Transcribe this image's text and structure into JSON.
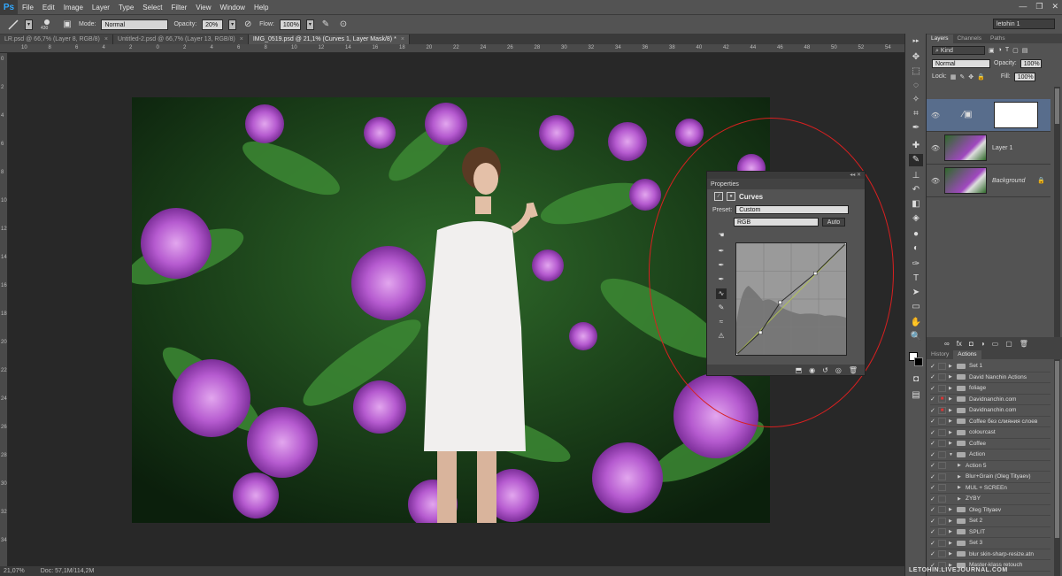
{
  "app": {
    "logo": "Ps",
    "icon_names": [
      "minimize-icon",
      "restore-icon",
      "close-icon"
    ]
  },
  "menu": [
    "File",
    "Edit",
    "Image",
    "Layer",
    "Type",
    "Select",
    "Filter",
    "View",
    "Window",
    "Help"
  ],
  "window_controls": {
    "minimize": "—",
    "restore": "❐",
    "close": "✕"
  },
  "options": {
    "brush_size": "430",
    "mode_label": "Mode:",
    "mode_value": "Normal",
    "opacity_label": "Opacity:",
    "opacity_value": "20%",
    "flow_label": "Flow:",
    "flow_value": "100%",
    "workspace": "letohin 1"
  },
  "tabs": [
    {
      "label": "LR.psd @ 66,7% (Layer 8, RGB/8)",
      "active": false
    },
    {
      "label": "Untitled-2.psd @ 66,7% (Layer 13, RGB/8)",
      "active": false
    },
    {
      "label": "IMG_0519.psd @ 21,1% (Curves 1, Layer Mask/8) *",
      "active": true
    }
  ],
  "ruler_top": [
    "10",
    "8",
    "6",
    "4",
    "2",
    "0",
    "2",
    "4",
    "6",
    "8",
    "10",
    "12",
    "14",
    "16",
    "18",
    "20",
    "22",
    "24",
    "26",
    "28",
    "30",
    "32",
    "34",
    "36",
    "38",
    "40",
    "42",
    "44",
    "46",
    "48",
    "50",
    "52",
    "54"
  ],
  "ruler_left": [
    "0",
    "2",
    "4",
    "6",
    "8",
    "10",
    "12",
    "14",
    "16",
    "18",
    "20",
    "22",
    "24",
    "26",
    "28",
    "30",
    "32",
    "34"
  ],
  "status": {
    "zoom": "21,07%",
    "doc": "Doc: 57,1M/114,2M"
  },
  "properties": {
    "panel_title": "Properties",
    "adjustment_name": "Curves",
    "preset_label": "Preset:",
    "preset_value": "Custom",
    "channel_value": "RGB",
    "auto_label": "Auto",
    "curve_points": [
      [
        0,
        0
      ],
      [
        0.22,
        0.2
      ],
      [
        0.4,
        0.47
      ],
      [
        0.72,
        0.73
      ],
      [
        1,
        1
      ]
    ]
  },
  "layers_panel": {
    "tabs": [
      "Layers",
      "Channels",
      "Paths"
    ],
    "kind_label": "Kind",
    "blend_mode": "Normal",
    "opacity_label": "Opacity:",
    "opacity_value": "100%",
    "lock_label": "Lock:",
    "fill_label": "Fill:",
    "fill_value": "100%",
    "layers": [
      {
        "name": "",
        "type": "curves-adjustment",
        "selected": true
      },
      {
        "name": "Layer 1",
        "type": "pixel",
        "selected": false
      },
      {
        "name": "Background",
        "type": "pixel",
        "selected": false
      }
    ]
  },
  "actions_panel": {
    "tabs": [
      "History",
      "Actions"
    ],
    "items": [
      {
        "label": "Set 1",
        "level": 0,
        "kind": "folder",
        "red": false
      },
      {
        "label": "David Nanchin Actions",
        "level": 0,
        "kind": "folder",
        "red": false
      },
      {
        "label": "foliage",
        "level": 0,
        "kind": "folder",
        "red": false
      },
      {
        "label": "Davidnanchin.com",
        "level": 0,
        "kind": "folder",
        "red": true
      },
      {
        "label": "Davidnanchin.com",
        "level": 0,
        "kind": "folder",
        "red": true
      },
      {
        "label": "Coffee без слияния слоев",
        "level": 0,
        "kind": "folder",
        "red": false
      },
      {
        "label": "colourcast",
        "level": 0,
        "kind": "folder",
        "red": false
      },
      {
        "label": "Coffee",
        "level": 0,
        "kind": "folder",
        "red": false
      },
      {
        "label": "Action",
        "level": 0,
        "kind": "folder-open",
        "red": false
      },
      {
        "label": "Action 5",
        "level": 1,
        "kind": "action",
        "red": false
      },
      {
        "label": "Blur+Grain (Oleg Tityaev)",
        "level": 1,
        "kind": "action",
        "red": false
      },
      {
        "label": "MUL + SCREEn",
        "level": 1,
        "kind": "action",
        "red": false
      },
      {
        "label": "ZYBY",
        "level": 1,
        "kind": "action",
        "red": false
      },
      {
        "label": "Oleg Tityaev",
        "level": 0,
        "kind": "folder",
        "red": false
      },
      {
        "label": "Set 2",
        "level": 0,
        "kind": "folder",
        "red": false
      },
      {
        "label": "SPLIT",
        "level": 0,
        "kind": "folder",
        "red": false
      },
      {
        "label": "Set 3",
        "level": 0,
        "kind": "folder",
        "red": false
      },
      {
        "label": "blur skin-sharp-resize.atn",
        "level": 0,
        "kind": "folder",
        "red": false
      },
      {
        "label": "Master-klass retouch",
        "level": 0,
        "kind": "folder",
        "red": false
      }
    ]
  },
  "watermark": "LETOHIN.LIVEJOURNAL.COM"
}
